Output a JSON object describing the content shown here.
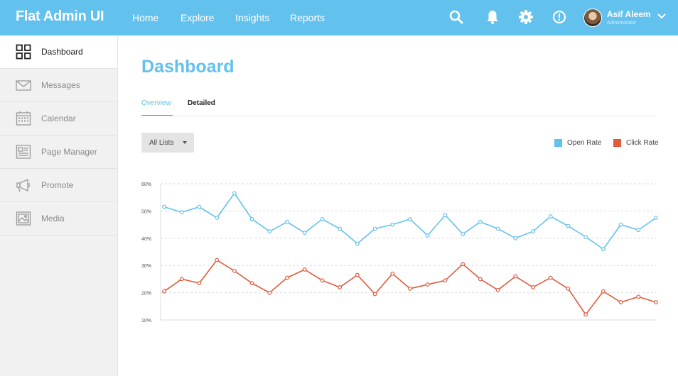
{
  "app": {
    "title": "Flat Admin UI"
  },
  "nav": {
    "items": [
      "Home",
      "Explore",
      "Insights",
      "Reports"
    ]
  },
  "topbar_icons": [
    "search-icon",
    "bell-icon",
    "gear-icon",
    "alert-icon"
  ],
  "user": {
    "name": "Asif Aleem",
    "role": "Administrator"
  },
  "sidebar": {
    "items": [
      {
        "label": "Dashboard",
        "icon": "grid-icon",
        "active": true
      },
      {
        "label": "Messages",
        "icon": "envelope-icon"
      },
      {
        "label": "Calendar",
        "icon": "calendar-icon"
      },
      {
        "label": "Page Manager",
        "icon": "document-icon"
      },
      {
        "label": "Promote",
        "icon": "megaphone-icon"
      },
      {
        "label": "Media",
        "icon": "image-icon"
      }
    ]
  },
  "main": {
    "title": "Dashboard",
    "tabs": [
      {
        "label": "Overview",
        "active": true
      },
      {
        "label": "Detailed"
      }
    ],
    "filter": {
      "label": "All Lists"
    }
  },
  "colors": {
    "accent": "#63c1ee",
    "open_rate": "#63c1ee",
    "click_rate": "#e05a3c"
  },
  "chart_data": {
    "type": "line",
    "title": "",
    "xlabel": "",
    "ylabel": "",
    "ylim": [
      10,
      60
    ],
    "yticks": [
      "60%",
      "50%",
      "40%",
      "30%",
      "20%",
      "10%"
    ],
    "grid": true,
    "legend": "top-right",
    "x": [
      1,
      2,
      3,
      4,
      5,
      6,
      7,
      8,
      9,
      10,
      11,
      12,
      13,
      14,
      15,
      16,
      17,
      18,
      19,
      20,
      21,
      22,
      23,
      24,
      25,
      26,
      27,
      28
    ],
    "series": [
      {
        "name": "Open Rate",
        "color": "#63c1ee",
        "values": [
          51.5,
          49.5,
          51.5,
          47.5,
          56.5,
          47,
          42.5,
          46,
          42,
          47,
          43.5,
          38,
          43.5,
          45,
          47,
          41,
          48.5,
          41.5,
          46,
          43.5,
          40,
          42.5,
          48,
          44.5,
          40.5,
          36,
          45,
          43,
          47.5
        ]
      },
      {
        "name": "Click Rate",
        "color": "#e05a3c",
        "values": [
          20.5,
          25,
          23.5,
          32,
          28,
          23.5,
          20,
          25.5,
          28.5,
          24.5,
          22,
          26.5,
          19.5,
          27,
          21.5,
          23,
          24.5,
          30.5,
          25,
          21,
          26,
          22,
          25.5,
          21.5,
          12,
          20.5,
          16.5,
          18.5,
          16.5
        ]
      }
    ]
  }
}
